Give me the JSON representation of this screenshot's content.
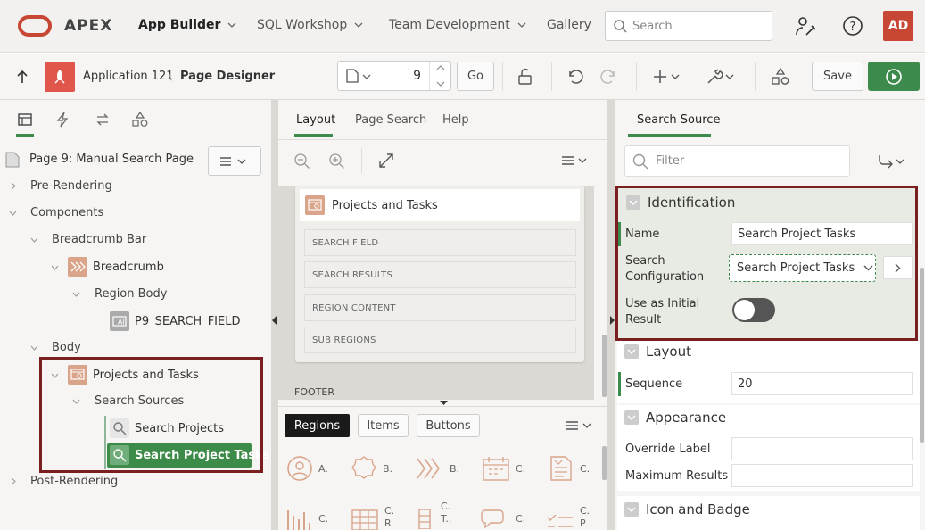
{
  "app": {
    "brand": "APEX",
    "user_initials": "AD"
  },
  "nav": [
    "App Builder",
    "SQL Workshop",
    "Team Development",
    "Gallery"
  ],
  "search": {
    "placeholder": "Search"
  },
  "breadcrumb": {
    "app": "Application 121",
    "separator": "\\",
    "page": "Page Designer"
  },
  "toolbar": {
    "page_number": "9",
    "go_label": "Go",
    "save_label": "Save"
  },
  "left": {
    "page_title": "Page 9: Manual Search Page",
    "tree": {
      "pre_rendering": "Pre-Rendering",
      "components": "Components",
      "breadcrumb_bar": "Breadcrumb Bar",
      "breadcrumb": "Breadcrumb",
      "region_body": "Region Body",
      "search_field": "P9_SEARCH_FIELD",
      "body": "Body",
      "projects_tasks": "Projects and Tasks",
      "search_sources": "Search Sources",
      "search_projects": "Search Projects",
      "search_project_tasks": "Search Project Tasks",
      "post_rendering": "Post-Rendering"
    }
  },
  "middle": {
    "tabs": [
      "Layout",
      "Page Search",
      "Help"
    ],
    "region_title": "Projects and Tasks",
    "slots": [
      "SEARCH FIELD",
      "SEARCH RESULTS",
      "REGION CONTENT",
      "SUB REGIONS"
    ],
    "footer": "FOOTER",
    "gallery_tabs": [
      "Regions",
      "Items",
      "Buttons"
    ],
    "gallery_row1": [
      "A.",
      "B.",
      "B.",
      "C.",
      "C."
    ],
    "gallery_row2": [
      "C.",
      "C.",
      "C.",
      "C."
    ],
    "gallery_row2_sub": [
      "R",
      "T..",
      "P"
    ]
  },
  "right": {
    "tab": "Search Source",
    "filter_placeholder": "Filter",
    "sections": {
      "identification": "Identification",
      "layout": "Layout",
      "appearance": "Appearance",
      "icon_badge": "Icon and Badge"
    },
    "props": {
      "name_label": "Name",
      "name_value": "Search Project Tasks",
      "config_label_1": "Search",
      "config_label_2": "Configuration",
      "config_value": "Search Project Tasks",
      "initial_label_1": "Use as Initial",
      "initial_label_2": "Result",
      "sequence_label": "Sequence",
      "sequence_value": "20",
      "override_label": "Override Label",
      "max_results_label": "Maximum Results"
    }
  },
  "colors": {
    "brand_red": "#c74634",
    "accent_green": "#3c8a4c",
    "highlight_box": "#7a1f1f",
    "selected_bg": "#3d8b48"
  }
}
